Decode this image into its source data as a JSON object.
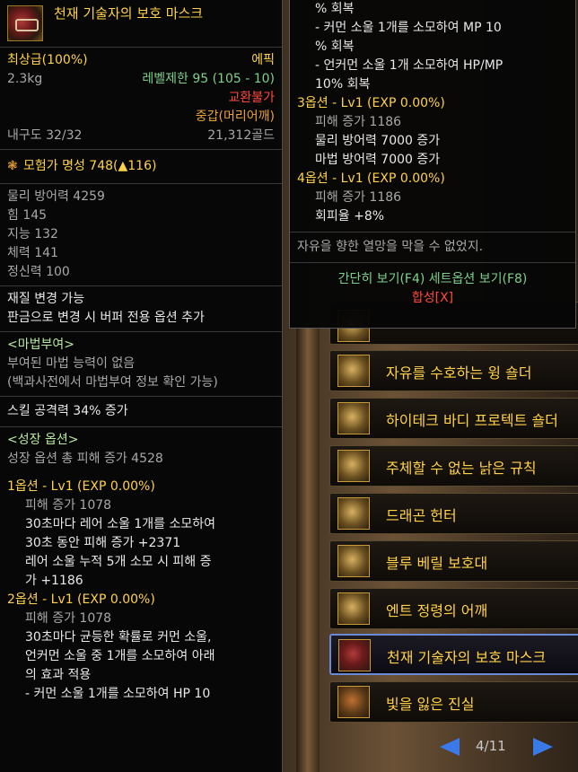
{
  "tooltip": {
    "item_name": "천재 기술자의 보호 마스크",
    "grade": "최상급(100%)",
    "rarity": "에픽",
    "weight": "2.3kg",
    "level_limit": "레벨제한 95 (105 - 10)",
    "trade": "교환불가",
    "slot": "중갑(머리어깨)",
    "durability": "내구도 32/32",
    "price": "21,312골드",
    "fame": "모험가 명성 748(▲116)",
    "stats": [
      "물리 방어력 4259",
      "힘 145",
      "지능 132",
      "체력 141",
      "정신력 100"
    ],
    "material": [
      "재질 변경 가능",
      "판금으로 변경 시 버퍼 전용 옵션 추가"
    ],
    "enchant": {
      "title": "<마법부여>",
      "lines": [
        "부여된 마법 능력이 없음",
        "(백과사전에서 마법부여 정보 확인 가능)"
      ]
    },
    "skill_attack": "스킬 공격력 34% 증가",
    "growth": {
      "title": "<성장 옵션>",
      "total": "성장 옵션 총 피해 증가 4528",
      "opt1_title": "1옵션 - Lv1 (EXP 0.00%)",
      "opt1_dmg": "피해 증가 1078",
      "opt1_lines": [
        "30초마다 레어 소울 1개를 소모하여",
        "30초 동안 피해 증가 +2371",
        "레어 소울 누적 5개 소모 시 피해 증",
        "가 +1186"
      ],
      "opt2_title": "2옵션 - Lv1 (EXP 0.00%)",
      "opt2_dmg": "피해 증가 1078",
      "opt2_lines": [
        "30초마다 균등한 확률로 커먼 소울,",
        "언커먼 소울 중 1개를 소모하여 아래",
        "의 효과 적용",
        "- 커먼 소울 1개를 소모하여 HP 10"
      ]
    }
  },
  "tooltip2": {
    "top_lines": [
      "% 회복",
      "- 커먼 소울 1개를 소모하여 MP 10",
      "% 회복",
      "- 언커먼 소울 1개 소모하여 HP/MP",
      "10% 회복"
    ],
    "opt3_title": "3옵션 - Lv1 (EXP 0.00%)",
    "opt3_dmg": "피해 증가 1186",
    "opt3_lines": [
      "물리 방어력 7000 증가",
      "마법 방어력 7000 증가"
    ],
    "opt4_title": "4옵션 - Lv1 (EXP 0.00%)",
    "opt4_dmg": "피해 증가 1186",
    "opt4_line": "회피율 +8%",
    "flavor": "자유을 향한 열망을 막을 수 없었지.",
    "footer1": "간단히 보기(F4) 세트옵션 보기(F8)",
    "footer2": "합성[X]"
  },
  "set_list": {
    "items": [
      "자유를 수호하는 윙 숄더",
      "하이테크 바디 프로텍트 숄더",
      "주체할 수 없는 낡은 규칙",
      "드래곤 헌터",
      "블루 베릴 보호대",
      "엔트 정령의 어깨",
      "천재 기술자의 보호 마스크",
      "빛을 잃은 진실"
    ],
    "selected_index": 6,
    "page": "4/11"
  }
}
